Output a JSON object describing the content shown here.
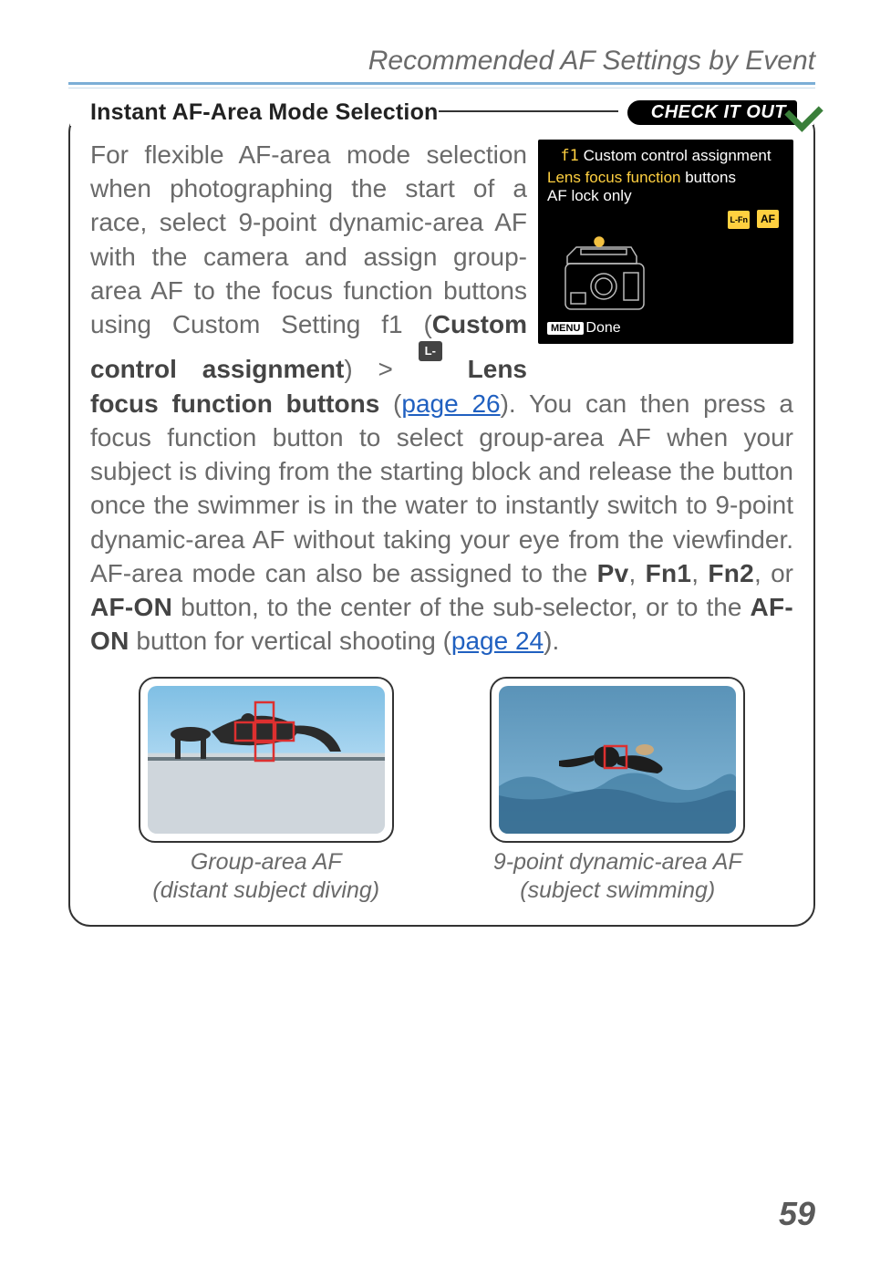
{
  "header": {
    "title": "Recommended AF Settings by Event"
  },
  "callout": {
    "title": "Instant AF-Area Mode Selection",
    "badge": "CHECK IT OUT"
  },
  "screen": {
    "tag": "f1",
    "title": "Custom control assignment",
    "line2a": "Lens focus function",
    "line2b": "buttons",
    "line3": "AF lock only",
    "icon1": "L-Fn",
    "icon2": "AF",
    "menu_label": "MENU",
    "done": "Done"
  },
  "body": {
    "p1a": "For flexible AF-area mode selection when photographing the start of a race, select 9-point dynamic-area AF with the camera and assign group-area AF to the focus function buttons using Custom Setting f1 (",
    "p1b_bold": "Custom control assignment",
    "p1c": ") > ",
    "lfn_text": "L-Fn",
    "p1d_bold": " Lens focus function buttons",
    "p1e": " (",
    "link1": "page 26",
    "p1f": "). You can then press a focus function button to select group-area AF when your subject is diving from the starting block and release the button once the swimmer is in the water to instantly switch to 9-point dynamic-area AF without taking your eye from the viewfinder.  AF-area mode can also be assigned to the ",
    "btn_pv": "Pv",
    "sep1": ", ",
    "btn_fn1": "Fn1",
    "sep2": ", ",
    "btn_fn2": "Fn2",
    "sep3": ", or ",
    "btn_afon": "AF-ON",
    "p1g": " button, to the center of the sub-selector, or to the ",
    "btn_afon2": "AF-ON",
    "p1h": " button for vertical shooting (",
    "link2": "page 24",
    "p1i": ")."
  },
  "figures": {
    "left": {
      "l1": "Group-area AF",
      "l2": "(distant subject diving)"
    },
    "right": {
      "l1": "9-point dynamic-area AF",
      "l2": "(subject swimming)"
    }
  },
  "page_number": "59"
}
